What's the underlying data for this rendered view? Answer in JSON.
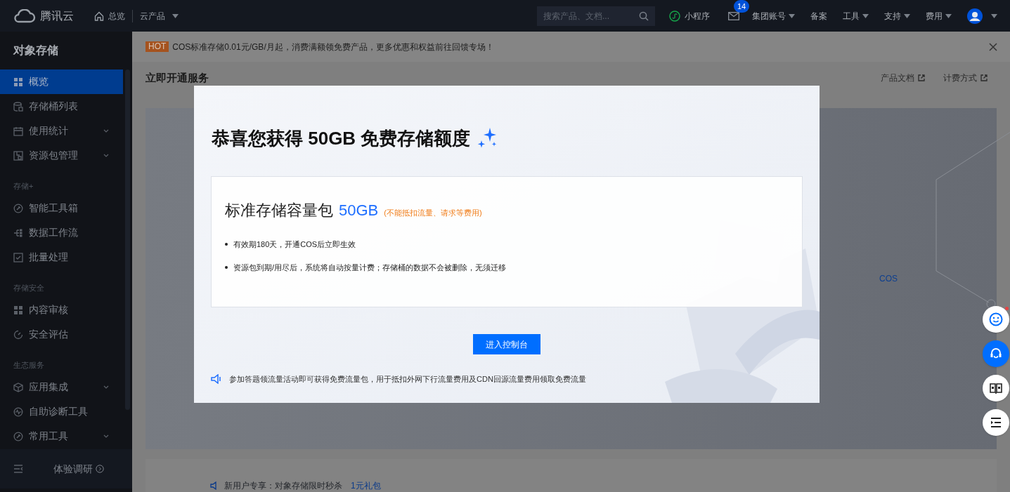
{
  "topbar": {
    "logo": "腾讯云",
    "nav": [
      {
        "kind": "home",
        "label": "总览"
      },
      {
        "kind": "dropdown",
        "label": "云产品"
      }
    ],
    "search": {
      "placeholder": "搜索产品、文档..."
    },
    "items": [
      {
        "kind": "miniapp",
        "label": "小程序"
      },
      {
        "kind": "mail",
        "badge": "14"
      },
      {
        "kind": "dropdown",
        "label": "集团账号"
      },
      {
        "kind": "plain",
        "label": "备案"
      },
      {
        "kind": "dropdown",
        "label": "工具"
      },
      {
        "kind": "dropdown",
        "label": "支持"
      },
      {
        "kind": "dropdown",
        "label": "费用"
      },
      {
        "kind": "avatar"
      }
    ]
  },
  "sidebar": {
    "title": "对象存储",
    "sections": [
      {
        "items": [
          {
            "kind": "grid",
            "label": "概览",
            "selected": true,
            "expandable": false
          },
          {
            "kind": "db",
            "label": "存储桶列表",
            "selected": false,
            "expandable": false
          },
          {
            "kind": "calendar",
            "label": "使用统计",
            "selected": false,
            "expandable": true
          },
          {
            "kind": "package",
            "label": "资源包管理",
            "selected": false,
            "expandable": true
          }
        ]
      },
      {
        "heading": "存储+",
        "items": [
          {
            "kind": "wrench",
            "label": "智能工具箱",
            "selected": false,
            "expandable": false
          },
          {
            "kind": "flow",
            "label": "数据工作流",
            "selected": false,
            "expandable": false
          },
          {
            "kind": "check",
            "label": "批量处理",
            "selected": false,
            "expandable": false
          }
        ]
      },
      {
        "heading": "存储安全",
        "items": [
          {
            "kind": "grid",
            "label": "内容审核",
            "selected": false,
            "expandable": false
          },
          {
            "kind": "gauge",
            "label": "安全评估",
            "selected": false,
            "expandable": false
          }
        ]
      },
      {
        "heading": "生态服务",
        "items": [
          {
            "kind": "cube",
            "label": "应用集成",
            "selected": false,
            "expandable": true
          },
          {
            "kind": "pulse",
            "label": "自助诊断工具",
            "selected": false,
            "expandable": false
          },
          {
            "kind": "wrench",
            "label": "常用工具",
            "selected": false,
            "expandable": true
          }
        ]
      }
    ],
    "footer": "体验调研"
  },
  "banner": {
    "tag": "HOT",
    "text": "COS标准存储0.01元/GB/月起，消费满额领免费产品，更多优惠和权益前往回馈专场！"
  },
  "page": {
    "title": "立即开通服务",
    "links": [
      "产品文档",
      "计费方式"
    ],
    "hero_label": "COS",
    "notice": "新用户专享：对象存储限时秒杀",
    "notice_link": "1元礼包"
  },
  "modal": {
    "title": "恭喜您获得 50GB 免费存储额度",
    "package": {
      "name": "标准存储容量包",
      "amount": "50GB",
      "note": "(不能抵扣流量、请求等费用)"
    },
    "bullets": [
      "有效期180天，开通COS后立即生效",
      "资源包到期/用尽后，系统将自动按量计费；存储桶的数据不会被删除，无须迁移"
    ],
    "button": "进入控制台",
    "notice": "参加答题领流量活动即可获得免费流量包，用于抵扣外网下行流量费用及CDN回源流量费用领取免费流量"
  },
  "float_buttons": [
    {
      "kind": "smile",
      "dot": true
    },
    {
      "kind": "headset",
      "dot": false
    },
    {
      "kind": "book",
      "dot": false
    },
    {
      "kind": "list",
      "dot": false
    }
  ]
}
